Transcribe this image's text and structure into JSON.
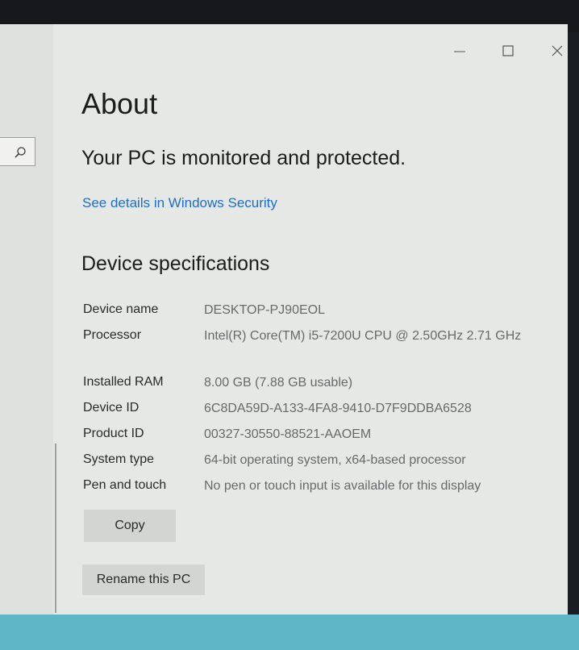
{
  "window": {
    "title": "About",
    "controls": {
      "minimize": "minimize-icon",
      "maximize": "maximize-icon",
      "close": "close-icon"
    }
  },
  "nav": {
    "search_icon": "search-icon"
  },
  "security": {
    "status": "Your PC is monitored and protected.",
    "link": "See details in Windows Security"
  },
  "specs": {
    "title": "Device specifications",
    "rows": [
      {
        "label": "Device name",
        "value": "DESKTOP-PJ90EOL"
      },
      {
        "label": "Processor",
        "value": "Intel(R) Core(TM) i5-7200U CPU @ 2.50GHz   2.71 GHz"
      },
      {
        "label": "Installed RAM",
        "value": "8.00 GB (7.88 GB usable)"
      },
      {
        "label": "Device ID",
        "value": "6C8DA59D-A133-4FA8-9410-D7F9DDBA6528"
      },
      {
        "label": "Product ID",
        "value": "00327-30550-88521-AAOEM"
      },
      {
        "label": "System type",
        "value": "64-bit operating system, x64-based processor"
      },
      {
        "label": "Pen and touch",
        "value": "No pen or touch input is available for this display"
      }
    ]
  },
  "buttons": {
    "copy": "Copy",
    "rename": "Rename this PC"
  },
  "colors": {
    "accent": "#1e6ec6",
    "window_bg": "#e6e8e5",
    "desktop": "#5fb6c4"
  }
}
